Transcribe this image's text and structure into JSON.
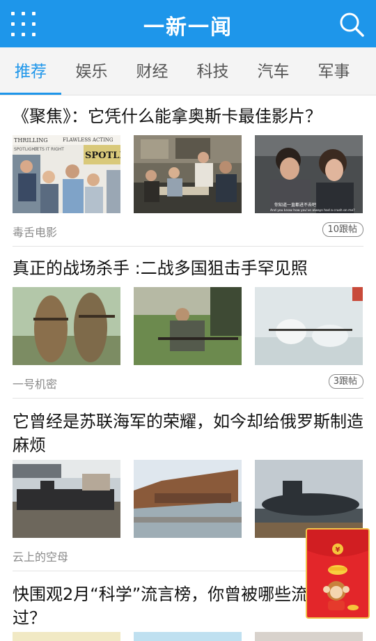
{
  "app": {
    "title": "一新一闻",
    "menu_icon": "grid-menu-icon",
    "search_icon": "search-icon"
  },
  "tabs": [
    {
      "label": "推荐",
      "active": true
    },
    {
      "label": "娱乐"
    },
    {
      "label": "财经"
    },
    {
      "label": "科技"
    },
    {
      "label": "汽车"
    },
    {
      "label": "军事"
    }
  ],
  "articles": [
    {
      "title": "《聚焦》：它凭什么能拿奥斯卡最佳影片？",
      "source": "毒舌电影",
      "comments": "10跟帖",
      "thumbs": [
        {
          "desc": "Spotlight magazine covers with cast",
          "texts": [
            "THRILLING",
            "FLAWLESS ACTING",
            "SPOTLIGHT",
            "GETS IT RIGHT",
            "SPOTLIGHT"
          ]
        },
        {
          "desc": "newsroom team around table"
        },
        {
          "desc": "two reporters talking",
          "caption": "你知道一直都进不去吧",
          "caption_en": "And you know how you've always had a crush on me?"
        }
      ]
    },
    {
      "title": "真正的战场杀手 :二战多国狙击手罕见照",
      "source": "一号机密",
      "comments": "3跟帖",
      "thumbs": [
        {
          "desc": "two snipers in ghillie suits"
        },
        {
          "desc": "soldier lying in grass with rifle"
        },
        {
          "desc": "soldiers in white camouflage in snow"
        }
      ]
    },
    {
      "title": "它曾经是苏联海军的荣耀，如今却给俄罗斯制造麻烦",
      "source": "云上的空母",
      "comments": "",
      "thumbs": [
        {
          "desc": "submarine in shipyard"
        },
        {
          "desc": "rusting submarine hulk in water"
        },
        {
          "desc": "submarine at pier"
        }
      ]
    },
    {
      "title": "快围观2月“科学”流言榜，你曾被哪些流言骗过？",
      "source": "",
      "comments": "",
      "thumbs": []
    }
  ],
  "floating": {
    "icon": "red-envelope-icon",
    "coin_symbol": "¥"
  }
}
